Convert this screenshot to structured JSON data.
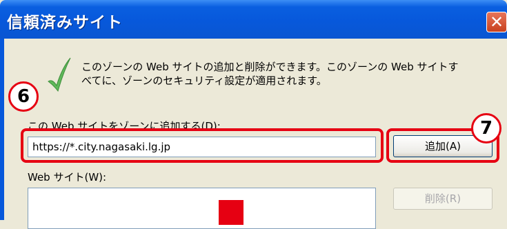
{
  "window": {
    "title": "信頼済みサイト",
    "close_symbol": "✕"
  },
  "description": {
    "line1": "このゾーンの Web サイトの追加と削除ができます。このゾーンの Web サイトす",
    "line2": "べてに、ゾーンのセキュリティ設定が適用されます。"
  },
  "add_zone": {
    "label": "この Web サイトをゾーンに追加する(D):",
    "value": "https://*.city.nagasaki.lg.jp",
    "button_label": "追加(A)"
  },
  "websites": {
    "label": "Web サイト(W):",
    "delete_label": "削除(R)"
  },
  "annotations": {
    "badge_6": "6",
    "badge_7": "7",
    "highlight_color": "#e60012"
  },
  "icons": {
    "check": "check-icon",
    "close": "close-icon"
  }
}
